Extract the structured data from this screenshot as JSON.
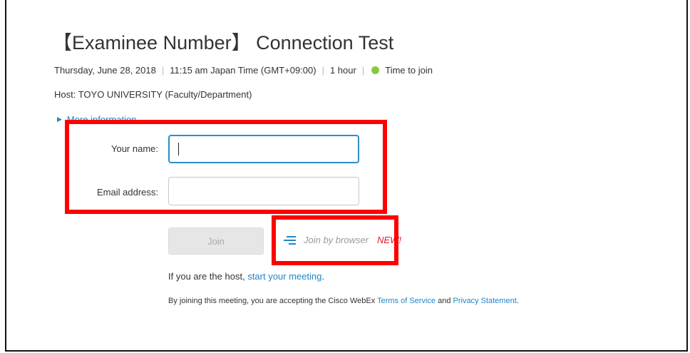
{
  "meeting": {
    "title": "【Examinee Number】 Connection Test",
    "date": "Thursday, June 28, 2018",
    "time": "11:15 am Japan Time (GMT+09:00)",
    "duration": "1 hour",
    "status": "Time to join",
    "status_color": "#8cc63f",
    "separator": "|",
    "host": "Host: TOYO UNIVERSITY (Faculty/Department)",
    "more_info": "More information"
  },
  "form": {
    "name_label": "Your name:",
    "name_value": "",
    "email_label": "Email address:",
    "email_value": "",
    "join_label": "Join",
    "join_browser_label": "Join by browser",
    "new_badge": "NEW!"
  },
  "host_line": {
    "prefix": "If you are the host,",
    "link": "start your meeting",
    "suffix": "."
  },
  "terms": {
    "prefix": "By joining this meeting, you are accepting the Cisco WebEx",
    "terms_link": "Terms of Service",
    "and": "and",
    "privacy_link": "Privacy Statement",
    "suffix": "."
  },
  "colors": {
    "link": "#1f86c8",
    "highlight": "#ff0000",
    "focus_border": "#2b8fc7"
  },
  "icons": {
    "expand": "triangle-right-icon",
    "browser": "browser-lines-icon"
  }
}
